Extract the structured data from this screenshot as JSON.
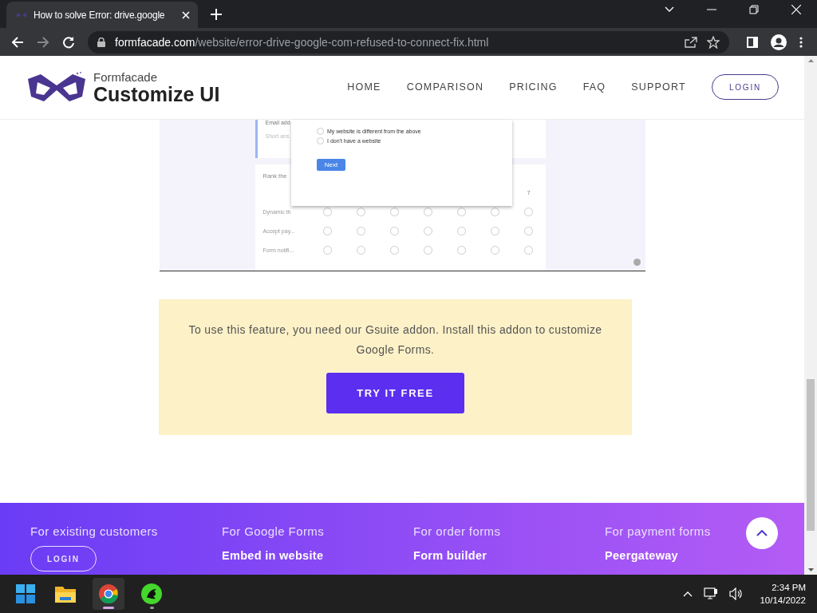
{
  "browser": {
    "tab": {
      "title": "How to solve Error: drive.google"
    },
    "url": {
      "domain": "formfacade.com",
      "path": "/website/error-drive-google-com-refused-to-connect-fix.html"
    }
  },
  "site": {
    "brand": {
      "top": "Formfacade",
      "name": "Customize UI"
    },
    "nav": [
      {
        "label": "HOME"
      },
      {
        "label": "COMPARISON"
      },
      {
        "label": "PRICING"
      },
      {
        "label": "FAQ"
      },
      {
        "label": "SUPPORT"
      }
    ],
    "login": "LOGIN"
  },
  "embed": {
    "fields": [
      "Email add",
      "Short ans"
    ],
    "options": [
      {
        "label": "My website is different from the above",
        "checked": false
      },
      {
        "label": "I don't have a website",
        "checked": false
      }
    ],
    "next": "Next",
    "rank_title": "Rank the",
    "scale_last": "7",
    "rows": [
      {
        "label": "Dynamic th",
        "checked": [
          false,
          false,
          false,
          false,
          false,
          false,
          false
        ]
      },
      {
        "label": "Accept pay...",
        "checked": [
          false,
          false,
          false,
          false,
          false,
          false,
          false
        ]
      },
      {
        "label": "Form notifi...",
        "checked": [
          false,
          false,
          false,
          false,
          false,
          false,
          false
        ]
      }
    ]
  },
  "notice": {
    "text": "To use this feature, you need our Gsuite addon. Install this addon to customize Google Forms.",
    "button": "TRY IT FREE"
  },
  "footer": {
    "columns": [
      {
        "heading": "For existing customers",
        "button": "LOGIN"
      },
      {
        "heading": "For Google Forms",
        "link": "Embed in website"
      },
      {
        "heading": "For order forms",
        "link": "Form builder"
      },
      {
        "heading": "For payment forms",
        "link": "Peergateway"
      }
    ]
  },
  "taskbar": {
    "apps": [
      {
        "kind": "files",
        "selected": false,
        "running": false
      },
      {
        "kind": "chrome",
        "selected": true,
        "running": true
      },
      {
        "kind": "razer",
        "selected": false,
        "running": true
      }
    ],
    "time": "2:34 PM",
    "date": "10/14/2022"
  }
}
